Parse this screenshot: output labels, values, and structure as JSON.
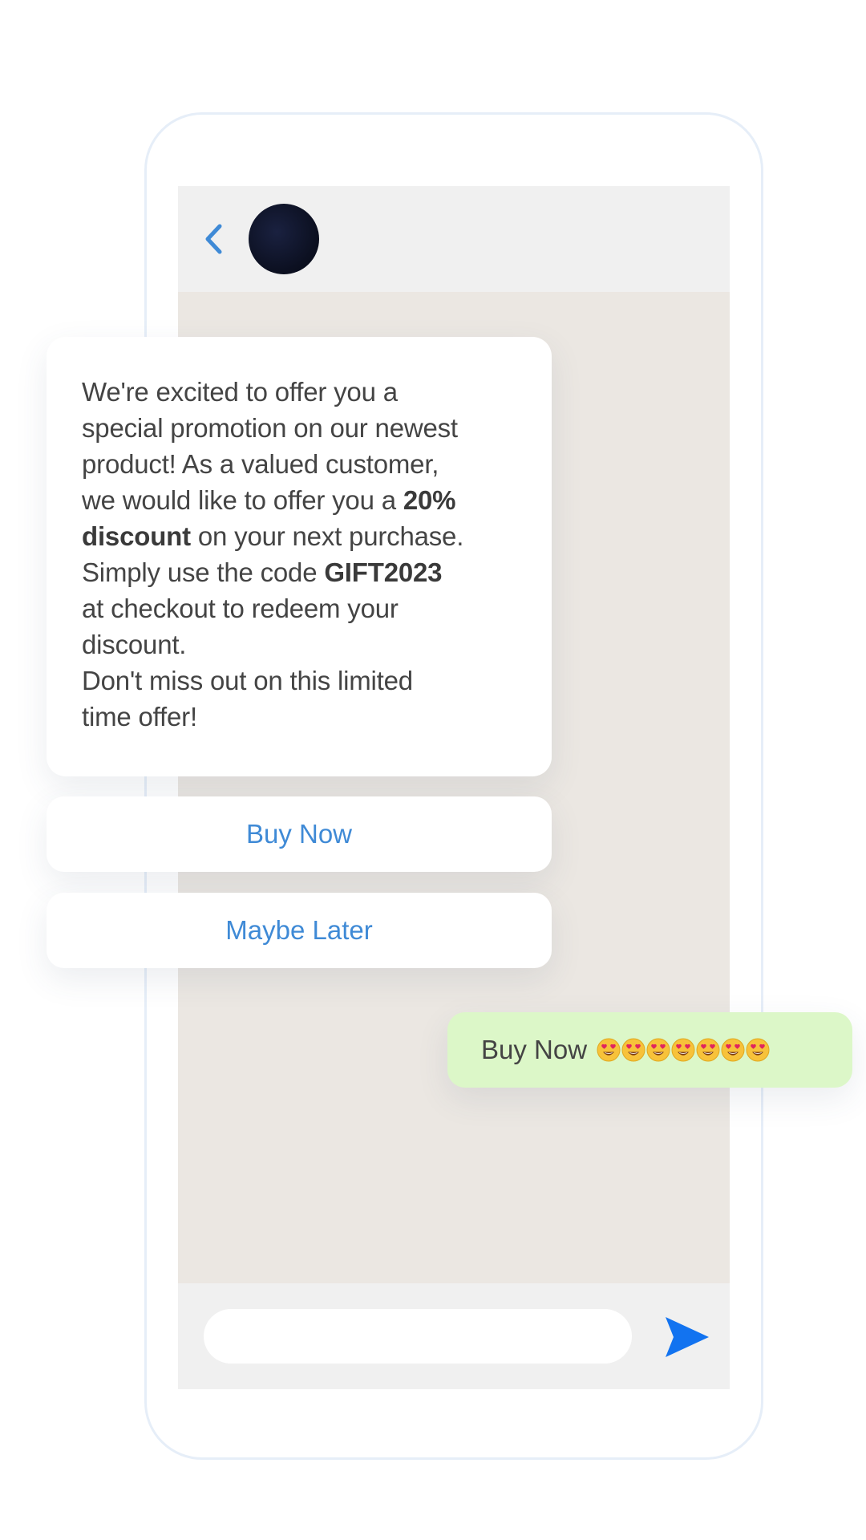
{
  "chat": {
    "message": {
      "line1": "We're excited to offer you a",
      "line2": "special promotion on our newest",
      "line3": "product! As a valued customer,",
      "line4_pre": "we would like to offer you a ",
      "line4_bold": "20%",
      "line5_bold": "discount",
      "line5_post": " on your next purchase.",
      "line6_pre": "Simply use the code ",
      "line6_bold": "GIFT2023",
      "line7": "at checkout to redeem your",
      "line8": "discount.",
      "line9": "Don't miss out on this limited",
      "line10": "time offer!"
    },
    "buttons": {
      "buy_now": "Buy Now",
      "maybe_later": "Maybe Later"
    },
    "reply": {
      "text": "Buy Now",
      "emoji_count": 7,
      "emoji_name": "heart-eyes-emoji"
    },
    "input": {
      "placeholder": "",
      "value": ""
    }
  },
  "icons": {
    "back": "chevron-left-icon",
    "send": "send-icon"
  },
  "colors": {
    "accent": "#1a73e8",
    "link_blue": "#3f8ad6",
    "chat_bg": "#ebe7e2",
    "header_bg": "#f0f0f0",
    "reply_bg": "#dcf7c8"
  }
}
